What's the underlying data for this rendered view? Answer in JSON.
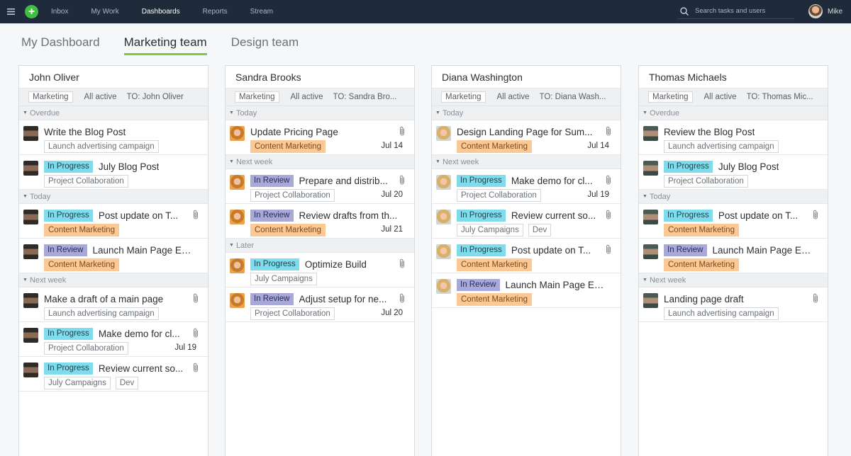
{
  "topbar": {
    "nav": [
      {
        "label": "Inbox",
        "active": false
      },
      {
        "label": "My Work",
        "active": false
      },
      {
        "label": "Dashboards",
        "active": true
      },
      {
        "label": "Reports",
        "active": false
      },
      {
        "label": "Stream",
        "active": false
      }
    ],
    "search_placeholder": "Search tasks and users",
    "user_name": "Mike",
    "accent_add": "#3fbf3f"
  },
  "tabs": [
    {
      "label": "My Dashboard",
      "active": false
    },
    {
      "label": "Marketing team",
      "active": true
    },
    {
      "label": "Design team",
      "active": false
    }
  ],
  "colors": {
    "in_progress": "#7fdcec",
    "in_review": "#a9a9d9",
    "content_marketing": "#fcc995",
    "active_tab": "#7ccb3a"
  },
  "columns": [
    {
      "name": "John Oliver",
      "avatar": "john",
      "filters": [
        "Marketing",
        "All active",
        "TO: John Oliver"
      ],
      "groups": [
        {
          "label": "Overdue",
          "tasks": [
            {
              "title": "Write the Blog Post",
              "status": "",
              "status_type": "",
              "tags": [
                {
                  "label": "Launch advertising campaign",
                  "type": "plain"
                }
              ],
              "attachment": false,
              "due": ""
            },
            {
              "title": "July Blog Post",
              "status": "In Progress",
              "status_type": "inprogress",
              "tags": [
                {
                  "label": "Project Collaboration",
                  "type": "plain"
                }
              ],
              "attachment": false,
              "due": ""
            }
          ]
        },
        {
          "label": "Today",
          "tasks": [
            {
              "title": "Post update on T...",
              "status": "In Progress",
              "status_type": "inprogress",
              "tags": [
                {
                  "label": "Content Marketing",
                  "type": "orange"
                }
              ],
              "attachment": true,
              "due": ""
            },
            {
              "title": "Launch Main Page Ex...",
              "status": "In Review",
              "status_type": "inreview",
              "tags": [
                {
                  "label": "Content Marketing",
                  "type": "orange"
                }
              ],
              "attachment": false,
              "due": ""
            }
          ]
        },
        {
          "label": "Next week",
          "tasks": [
            {
              "title": "Make a draft of a main page",
              "status": "",
              "status_type": "",
              "tags": [
                {
                  "label": "Launch advertising campaign",
                  "type": "plain"
                }
              ],
              "attachment": true,
              "due": ""
            },
            {
              "title": "Make demo for cl...",
              "status": "In Progress",
              "status_type": "inprogress",
              "tags": [
                {
                  "label": "Project Collaboration",
                  "type": "plain"
                }
              ],
              "attachment": true,
              "due": "Jul 19"
            },
            {
              "title": "Review current so...",
              "status": "In Progress",
              "status_type": "inprogress",
              "tags": [
                {
                  "label": "July Campaigns",
                  "type": "plain"
                },
                {
                  "label": "Dev",
                  "type": "plain"
                }
              ],
              "attachment": true,
              "due": ""
            }
          ]
        }
      ]
    },
    {
      "name": "Sandra Brooks",
      "avatar": "sandra",
      "filters": [
        "Marketing",
        "All active",
        "TO: Sandra Bro..."
      ],
      "groups": [
        {
          "label": "Today",
          "tasks": [
            {
              "title": "Update Pricing Page",
              "status": "",
              "status_type": "",
              "tags": [
                {
                  "label": "Content Marketing",
                  "type": "orange"
                }
              ],
              "attachment": true,
              "due": "Jul 14"
            }
          ]
        },
        {
          "label": "Next week",
          "tasks": [
            {
              "title": "Prepare and distrib...",
              "status": "In Review",
              "status_type": "inreview",
              "tags": [
                {
                  "label": "Project Collaboration",
                  "type": "plain"
                }
              ],
              "attachment": true,
              "due": "Jul 20"
            },
            {
              "title": "Review drafts from th...",
              "status": "In Review",
              "status_type": "inreview",
              "tags": [
                {
                  "label": "Content Marketing",
                  "type": "orange"
                }
              ],
              "attachment": false,
              "due": "Jul 21"
            }
          ]
        },
        {
          "label": "Later",
          "tasks": [
            {
              "title": "Optimize Build",
              "status": "In Progress",
              "status_type": "inprogress",
              "tags": [
                {
                  "label": "July Campaigns",
                  "type": "plain"
                }
              ],
              "attachment": true,
              "due": ""
            },
            {
              "title": "Adjust setup for ne...",
              "status": "In Review",
              "status_type": "inreview",
              "tags": [
                {
                  "label": "Project Collaboration",
                  "type": "plain"
                }
              ],
              "attachment": true,
              "due": "Jul 20"
            }
          ]
        }
      ]
    },
    {
      "name": "Diana Washington",
      "avatar": "diana",
      "filters": [
        "Marketing",
        "All active",
        "TO: Diana Wash..."
      ],
      "groups": [
        {
          "label": "Today",
          "tasks": [
            {
              "title": "Design Landing Page for Sum...",
              "status": "",
              "status_type": "",
              "tags": [
                {
                  "label": "Content Marketing",
                  "type": "orange"
                }
              ],
              "attachment": true,
              "due": "Jul 14"
            }
          ]
        },
        {
          "label": "Next week",
          "tasks": [
            {
              "title": "Make demo for cl...",
              "status": "In Progress",
              "status_type": "inprogress",
              "tags": [
                {
                  "label": "Project Collaboration",
                  "type": "plain"
                }
              ],
              "attachment": true,
              "due": "Jul 19"
            },
            {
              "title": "Review current so...",
              "status": "In Progress",
              "status_type": "inprogress",
              "tags": [
                {
                  "label": "July Campaigns",
                  "type": "plain"
                },
                {
                  "label": "Dev",
                  "type": "plain"
                }
              ],
              "attachment": true,
              "due": ""
            },
            {
              "title": "Post update on T...",
              "status": "In Progress",
              "status_type": "inprogress",
              "tags": [
                {
                  "label": "Content Marketing",
                  "type": "orange"
                }
              ],
              "attachment": true,
              "due": ""
            },
            {
              "title": "Launch Main Page Ex...",
              "status": "In Review",
              "status_type": "inreview",
              "tags": [
                {
                  "label": "Content Marketing",
                  "type": "orange"
                }
              ],
              "attachment": false,
              "due": ""
            }
          ]
        }
      ]
    },
    {
      "name": "Thomas Michaels",
      "avatar": "thomas",
      "filters": [
        "Marketing",
        "All active",
        "TO: Thomas Mic..."
      ],
      "groups": [
        {
          "label": "Overdue",
          "tasks": [
            {
              "title": "Review the Blog Post",
              "status": "",
              "status_type": "",
              "tags": [
                {
                  "label": "Launch advertising campaign",
                  "type": "plain"
                }
              ],
              "attachment": false,
              "due": ""
            },
            {
              "title": "July Blog Post",
              "status": "In Progress",
              "status_type": "inprogress",
              "tags": [
                {
                  "label": "Project Collaboration",
                  "type": "plain"
                }
              ],
              "attachment": false,
              "due": ""
            }
          ]
        },
        {
          "label": "Today",
          "tasks": [
            {
              "title": "Post update on T...",
              "status": "In Progress",
              "status_type": "inprogress",
              "tags": [
                {
                  "label": "Content Marketing",
                  "type": "orange"
                }
              ],
              "attachment": true,
              "due": ""
            },
            {
              "title": "Launch Main Page Ex...",
              "status": "In Review",
              "status_type": "inreview",
              "tags": [
                {
                  "label": "Content Marketing",
                  "type": "orange"
                }
              ],
              "attachment": false,
              "due": ""
            }
          ]
        },
        {
          "label": "Next week",
          "tasks": [
            {
              "title": "Landing page draft",
              "status": "",
              "status_type": "",
              "tags": [
                {
                  "label": "Launch advertising campaign",
                  "type": "plain"
                }
              ],
              "attachment": true,
              "due": ""
            }
          ]
        }
      ]
    }
  ]
}
